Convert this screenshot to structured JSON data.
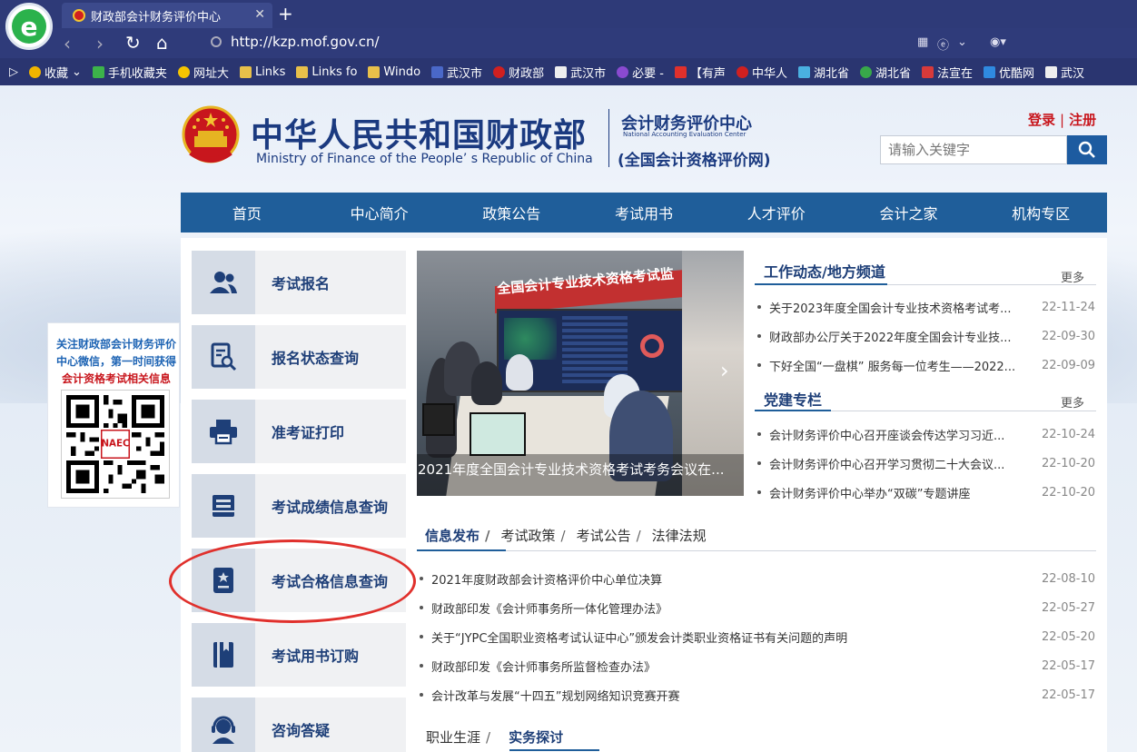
{
  "browser": {
    "tab_title": "财政部会计财务评价中心",
    "url": "http://kzp.mof.gov.cn/",
    "bookmarks": [
      "收藏",
      "手机收藏夹",
      "网址大",
      "Links",
      "Links fo",
      "Windo",
      "武汉市",
      "财政部",
      "武汉市",
      "必要 -",
      "【有声",
      "中华人",
      "湖北省",
      "湖北省",
      "法宣在",
      "优酷网",
      "武汉"
    ]
  },
  "header": {
    "title_cn": "中华人民共和国财政部",
    "title_en": "Ministry of Finance of the People’ s Republic of China",
    "center_cn": "会计财务评价中心",
    "center_en": "National Accounting Evaluation Center",
    "center_sub": "(全国会计资格评价网)",
    "login": "登录",
    "register": "注册",
    "search_placeholder": "请输入关键字"
  },
  "nav": [
    "首页",
    "中心简介",
    "政策公告",
    "考试用书",
    "人才评价",
    "会计之家",
    "机构专区"
  ],
  "qr": {
    "line1": "关注财政部会计财务评价中心微信，第一时间获得",
    "line2": "会计资格考试相关信息",
    "badge": "NAEC"
  },
  "services": [
    "考试报名",
    "报名状态查询",
    "准考证打印",
    "考试成绩信息查询",
    "考试合格信息查询",
    "考试用书订购",
    "咨询答疑"
  ],
  "slider": {
    "banner": "全国会计专业技术资格考试监",
    "caption": "2021年度全国会计专业技术资格考试考务会议在..."
  },
  "work": {
    "title": "工作动态/地方频道",
    "more": "更多",
    "items": [
      {
        "title": "关于2023年度全国会计专业技术资格考试考...",
        "date": "22-11-24"
      },
      {
        "title": "财政部办公厅关于2022年度全国会计专业技...",
        "date": "22-09-30"
      },
      {
        "title": "下好全国“一盘棋” 服务每一位考生——2022...",
        "date": "22-09-09"
      }
    ]
  },
  "party": {
    "title": "党建专栏",
    "more": "更多",
    "items": [
      {
        "title": "会计财务评价中心召开座谈会传达学习习近...",
        "date": "22-10-24"
      },
      {
        "title": "会计财务评价中心召开学习贯彻二十大会议...",
        "date": "22-10-20"
      },
      {
        "title": "会计财务评价中心举办“双碳”专题讲座",
        "date": "22-10-20"
      }
    ]
  },
  "info": {
    "tabs": [
      "信息发布",
      "考试政策",
      "考试公告",
      "法律法规"
    ],
    "items": [
      {
        "title": "2021年度财政部会计资格评价中心单位决算",
        "date": "22-08-10"
      },
      {
        "title": "财政部印发《会计师事务所一体化管理办法》",
        "date": "22-05-27"
      },
      {
        "title": "关于“JYPC全国职业资格考试认证中心”颁发会计类职业资格证书有关问题的声明",
        "date": "22-05-20"
      },
      {
        "title": "财政部印发《会计师事务所监督检查办法》",
        "date": "22-05-17"
      },
      {
        "title": "会计改革与发展“十四五”规划网络知识竞赛开赛",
        "date": "22-05-17"
      }
    ]
  },
  "bottom_tabs": [
    "职业生涯",
    "实务探讨"
  ],
  "colors": {
    "brand_blue": "#1f5e9a",
    "title_blue": "#1b3a80",
    "accent_red": "#c8161d",
    "annotation_red": "#e0302c"
  }
}
